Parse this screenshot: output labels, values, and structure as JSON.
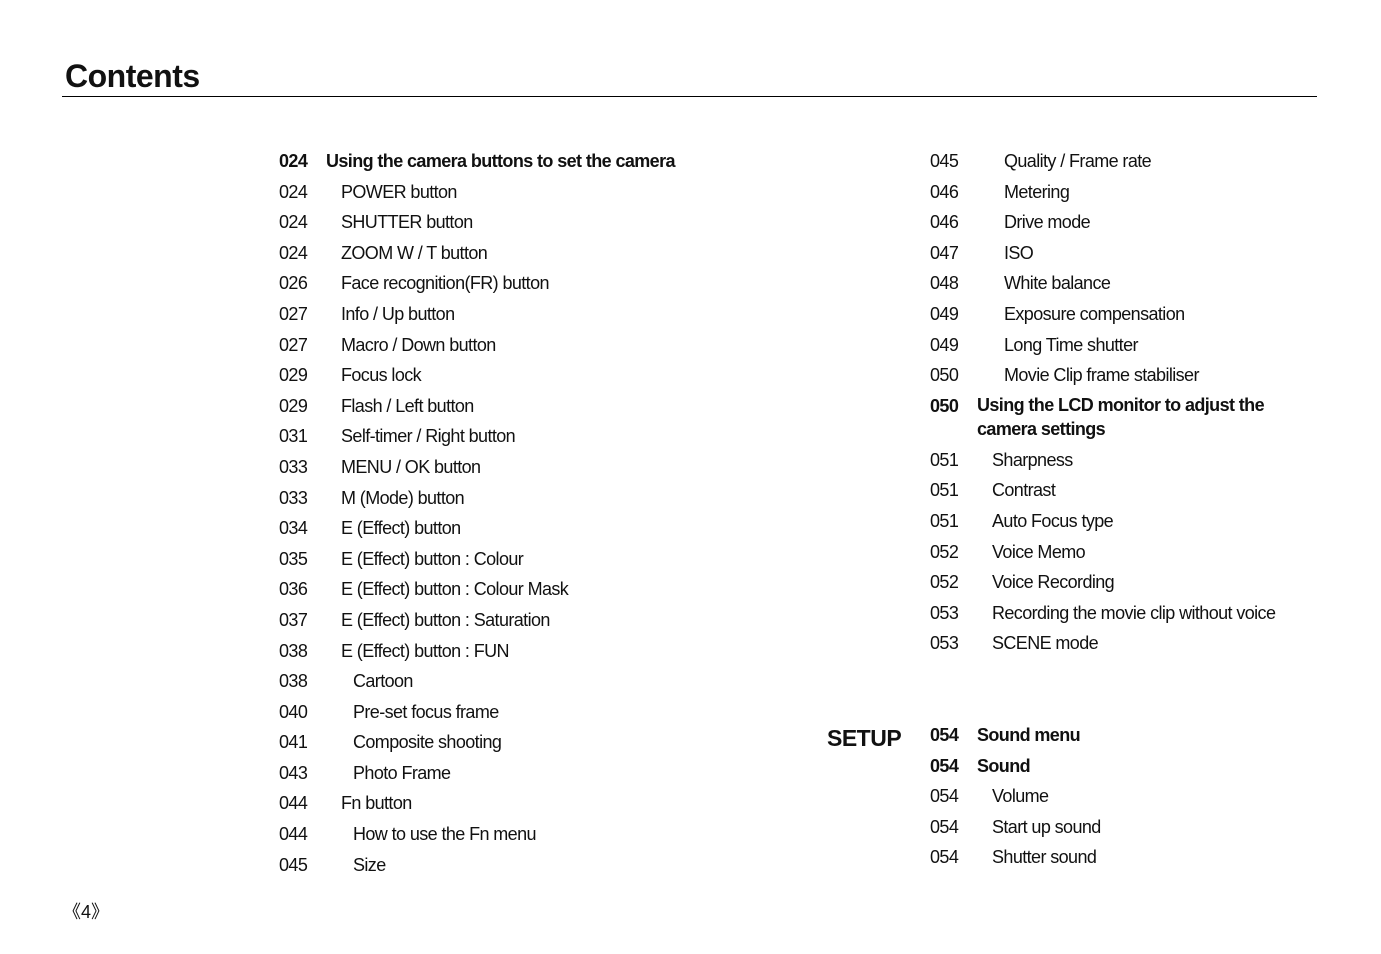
{
  "page_title": "Contents",
  "page_number": "《4》",
  "left_column": [
    {
      "page": "024",
      "label": "Using the camera buttons to set the camera",
      "level": 0
    },
    {
      "page": "024",
      "label": "POWER button",
      "level": 1
    },
    {
      "page": "024",
      "label": "SHUTTER button",
      "level": 1
    },
    {
      "page": "024",
      "label": "ZOOM W / T button",
      "level": 1
    },
    {
      "page": "026",
      "label": "Face recognition(FR) button",
      "level": 1
    },
    {
      "page": "027",
      "label": "Info / Up button",
      "level": 1
    },
    {
      "page": "027",
      "label": "Macro / Down button",
      "level": 1
    },
    {
      "page": "029",
      "label": "Focus lock",
      "level": 1
    },
    {
      "page": "029",
      "label": "Flash / Left button",
      "level": 1
    },
    {
      "page": "031",
      "label": "Self-timer / Right button",
      "level": 1
    },
    {
      "page": "033",
      "label": "MENU / OK button",
      "level": 1
    },
    {
      "page": "033",
      "label": "M (Mode) button",
      "level": 1
    },
    {
      "page": "034",
      "label": "E (Effect) button",
      "level": 1
    },
    {
      "page": "035",
      "label": "E (Effect) button : Colour",
      "level": 1
    },
    {
      "page": "036",
      "label": "E (Effect) button : Colour Mask",
      "level": 1
    },
    {
      "page": "037",
      "label": "E (Effect) button : Saturation",
      "level": 1
    },
    {
      "page": "038",
      "label": "E (Effect) button : FUN",
      "level": 1
    },
    {
      "page": "038",
      "label": "Cartoon",
      "level": 2
    },
    {
      "page": "040",
      "label": "Pre-set focus frame",
      "level": 2
    },
    {
      "page": "041",
      "label": "Composite shooting",
      "level": 2
    },
    {
      "page": "043",
      "label": "Photo Frame",
      "level": 2
    },
    {
      "page": "044",
      "label": "Fn button",
      "level": 1
    },
    {
      "page": "044",
      "label": "How to use the Fn menu",
      "level": 2
    },
    {
      "page": "045",
      "label": "Size",
      "level": 2
    }
  ],
  "right_column": [
    {
      "page": "045",
      "label": "Quality / Frame rate",
      "level": 2
    },
    {
      "page": "046",
      "label": "Metering",
      "level": 2
    },
    {
      "page": "046",
      "label": "Drive mode",
      "level": 2
    },
    {
      "page": "047",
      "label": "ISO",
      "level": 2
    },
    {
      "page": "048",
      "label": "White balance",
      "level": 2
    },
    {
      "page": "049",
      "label": "Exposure compensation",
      "level": 2
    },
    {
      "page": "049",
      "label": "Long Time shutter",
      "level": 2
    },
    {
      "page": "050",
      "label": "Movie Clip frame stabiliser",
      "level": 2
    },
    {
      "page": "050",
      "label": "Using the LCD monitor to adjust the camera settings",
      "level": 0
    },
    {
      "page": "051",
      "label": "Sharpness",
      "level": 1
    },
    {
      "page": "051",
      "label": "Contrast",
      "level": 1
    },
    {
      "page": "051",
      "label": "Auto Focus type",
      "level": 1
    },
    {
      "page": "052",
      "label": "Voice Memo",
      "level": 1
    },
    {
      "page": "052",
      "label": "Voice Recording",
      "level": 1
    },
    {
      "page": "053",
      "label": "Recording the movie clip without voice",
      "level": 1
    },
    {
      "page": "053",
      "label": "SCENE mode",
      "level": 1
    }
  ],
  "setup_section": {
    "heading": "SETUP",
    "items": [
      {
        "page": "054",
        "label": "Sound menu",
        "level": 0
      },
      {
        "page": "054",
        "label": "Sound",
        "level": 0
      },
      {
        "page": "054",
        "label": "Volume",
        "level": 1
      },
      {
        "page": "054",
        "label": "Start up sound",
        "level": 1
      },
      {
        "page": "054",
        "label": "Shutter sound",
        "level": 1
      }
    ]
  }
}
